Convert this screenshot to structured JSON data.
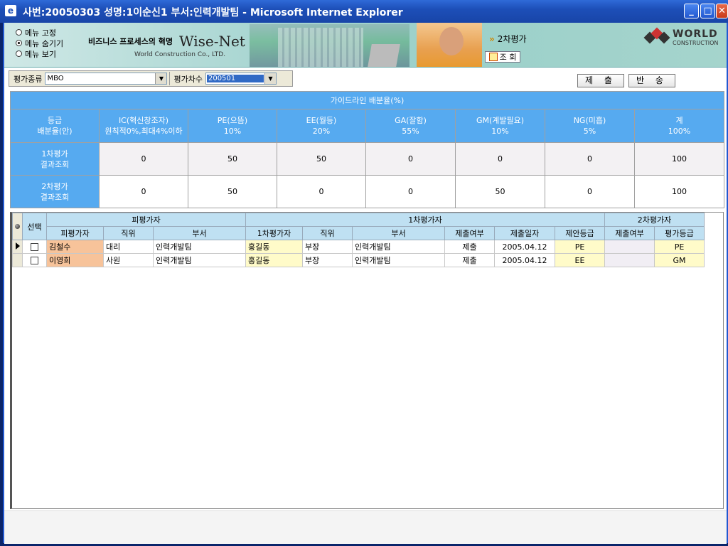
{
  "window": {
    "title": "사번:20050303 성명:1이순신1 부서:인력개발팀 - Microsoft Internet Explorer",
    "app_icon": "e"
  },
  "header": {
    "menu_options": [
      "메뉴 고정",
      "메뉴 숨기기",
      "메뉴 보기"
    ],
    "menu_selected_index": 1,
    "slogan": "비즈니스 프로세스의 혁명",
    "brand": "Wise-Net",
    "brand_sub": "World Construction Co., LTD.",
    "nav_arrow": "»",
    "nav_label": "2차평가",
    "query_button": "조 회",
    "logo_text": "WORLD",
    "logo_sub": "CONSTRUCTION"
  },
  "filters": {
    "type_label": "평가종류",
    "type_value": "MBO",
    "round_label": "평가차수",
    "round_value": "200501"
  },
  "actions": {
    "submit": "제 출",
    "return": "반 송"
  },
  "guide": {
    "title": "가이드라인 배분율(%)",
    "corner_line1": "등급",
    "corner_line2": "배분율(안)",
    "columns": [
      {
        "line1": "IC(혁신창조자)",
        "line2": "원칙적0%,최대4%이하"
      },
      {
        "line1": "PE(으뜸)",
        "line2": "10%"
      },
      {
        "line1": "EE(월등)",
        "line2": "20%"
      },
      {
        "line1": "GA(잘함)",
        "line2": "55%"
      },
      {
        "line1": "GM(계발필요)",
        "line2": "10%"
      },
      {
        "line1": "NG(미흡)",
        "line2": "5%"
      },
      {
        "line1": "계",
        "line2": "100%"
      }
    ],
    "rows": [
      {
        "line1": "1차평가",
        "line2": "결과조회",
        "values": [
          "0",
          "50",
          "50",
          "0",
          "0",
          "0",
          "100"
        ]
      },
      {
        "line1": "2차평가",
        "line2": "결과조회",
        "values": [
          "0",
          "50",
          "0",
          "0",
          "50",
          "0",
          "100"
        ]
      }
    ]
  },
  "grid": {
    "select_header": "선택",
    "groups": [
      "피평가자",
      "1차평가자",
      "2차평가자"
    ],
    "columns": [
      "피평가자",
      "직위",
      "부서",
      "1차평가자",
      "직위",
      "부서",
      "제출여부",
      "제출일자",
      "제안등급",
      "제출여부",
      "평가등급"
    ],
    "rows": [
      {
        "name": "김철수",
        "position": "대리",
        "dept": "인력개발팀",
        "eval1": "홍길동",
        "eval1_position": "부장",
        "eval1_dept": "인력개발팀",
        "submitted": "제출",
        "date": "2005.04.12",
        "proposed_grade": "PE",
        "submitted2": "",
        "final_grade": "PE"
      },
      {
        "name": "이영희",
        "position": "사원",
        "dept": "인력개발팀",
        "eval1": "홍길동",
        "eval1_position": "부장",
        "eval1_dept": "인력개발팀",
        "submitted": "제출",
        "date": "2005.04.12",
        "proposed_grade": "EE",
        "submitted2": "",
        "final_grade": "GM"
      }
    ]
  },
  "colors": {
    "titlebar": "#1d4fb8",
    "table_header": "#56aaf0",
    "grid_header": "#bfe0f2",
    "name_cell": "#f7c39a",
    "highlight_cell": "#fffbc9"
  }
}
